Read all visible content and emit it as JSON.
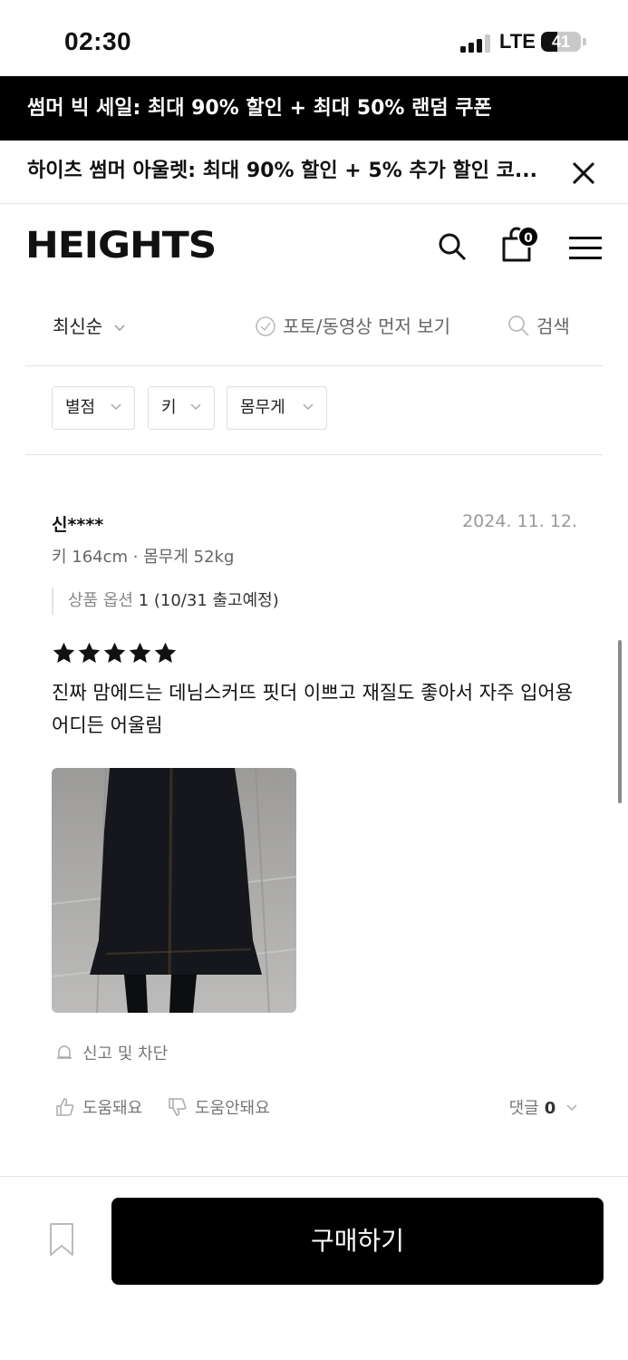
{
  "status": {
    "time": "02:30",
    "network": "LTE",
    "battery_percent": "41",
    "battery_level": 0.41,
    "signal_bars": 3
  },
  "banners": {
    "primary": "썸머 빅 세일: 최대 90% 할인 + 최대 50% 랜덤 쿠폰",
    "secondary": "하이츠 썸머 아울렛: 최대 90% 할인 + 5% 추가 할인 코..."
  },
  "header": {
    "logo": "HEIGHTS",
    "cart_count": "0"
  },
  "sortbar": {
    "sort_label": "최신순",
    "photo_first_label": "포토/동영상 먼저 보기",
    "search_label": "검색"
  },
  "filters": [
    "별점",
    "키",
    "몸무게"
  ],
  "review": {
    "reviewer": "신****",
    "date": "2024. 11. 12.",
    "body_info": "키 164cm · 몸무게 52kg",
    "option_label": "상품 옵션",
    "option_value": "1 (10/31 출고예정)",
    "rating": 5,
    "text": "진짜 맘에드는 데님스커뜨 핏더 이쁘고 재질도 좋아서 자주 입어용 어디든 어울림",
    "report_label": "신고 및 차단",
    "helpful_label": "도움돼요",
    "not_helpful_label": "도움안돼요",
    "comments_label": "댓글",
    "comments_count": "0"
  },
  "bottom": {
    "buy_label": "구매하기"
  }
}
